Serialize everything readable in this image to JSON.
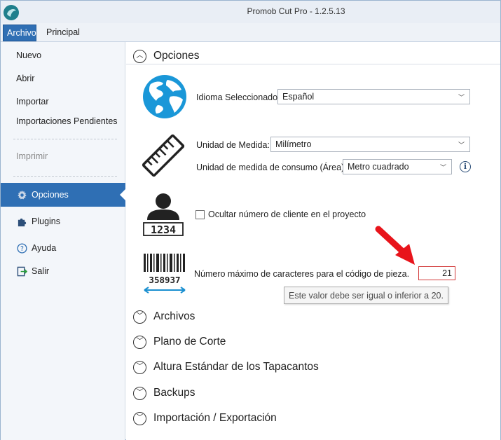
{
  "window": {
    "title": "Promob Cut Pro - 1.2.5.13"
  },
  "ribbon": {
    "tabs": [
      {
        "label": "Archivo"
      },
      {
        "label": "Principal"
      }
    ]
  },
  "sidebar": {
    "items": {
      "nuevo": "Nuevo",
      "abrir": "Abrir",
      "importar": "Importar",
      "importaciones": "Importaciones Pendientes",
      "imprimir": "Imprimir"
    },
    "nav": [
      {
        "label": "Opciones",
        "icon": "gear-icon"
      },
      {
        "label": "Plugins",
        "icon": "puzzle-icon"
      },
      {
        "label": "Ayuda",
        "icon": "help-icon"
      },
      {
        "label": "Salir",
        "icon": "exit-icon"
      }
    ]
  },
  "options": {
    "header": "Opciones",
    "language": {
      "label": "Idioma Seleccionado:",
      "value": "Español"
    },
    "unit": {
      "label": "Unidad de Medida:",
      "value": "Milímetro"
    },
    "area_unit": {
      "label": "Unidad de medida de consumo (Área):",
      "value": "Metro cuadrado"
    },
    "client_badge": "1234",
    "hide_client": {
      "label": "Ocultar número de cliente en el proyecto",
      "checked": false
    },
    "barcode_number": "358937",
    "max_chars": {
      "label": "Número máximo de caracteres para el código de pieza.",
      "value": "21"
    },
    "tooltip": "Este valor debe ser igual o inferior a 20."
  },
  "sections": [
    {
      "label": "Archivos"
    },
    {
      "label": "Plano de Corte"
    },
    {
      "label": "Altura Estándar de los Tapacantos"
    },
    {
      "label": "Backups"
    },
    {
      "label": "Importación / Exportación"
    }
  ],
  "colors": {
    "accent": "#2f6fb4",
    "error": "#d23a3a",
    "arrow": "#e8141b",
    "globe": "#1a97d8"
  }
}
